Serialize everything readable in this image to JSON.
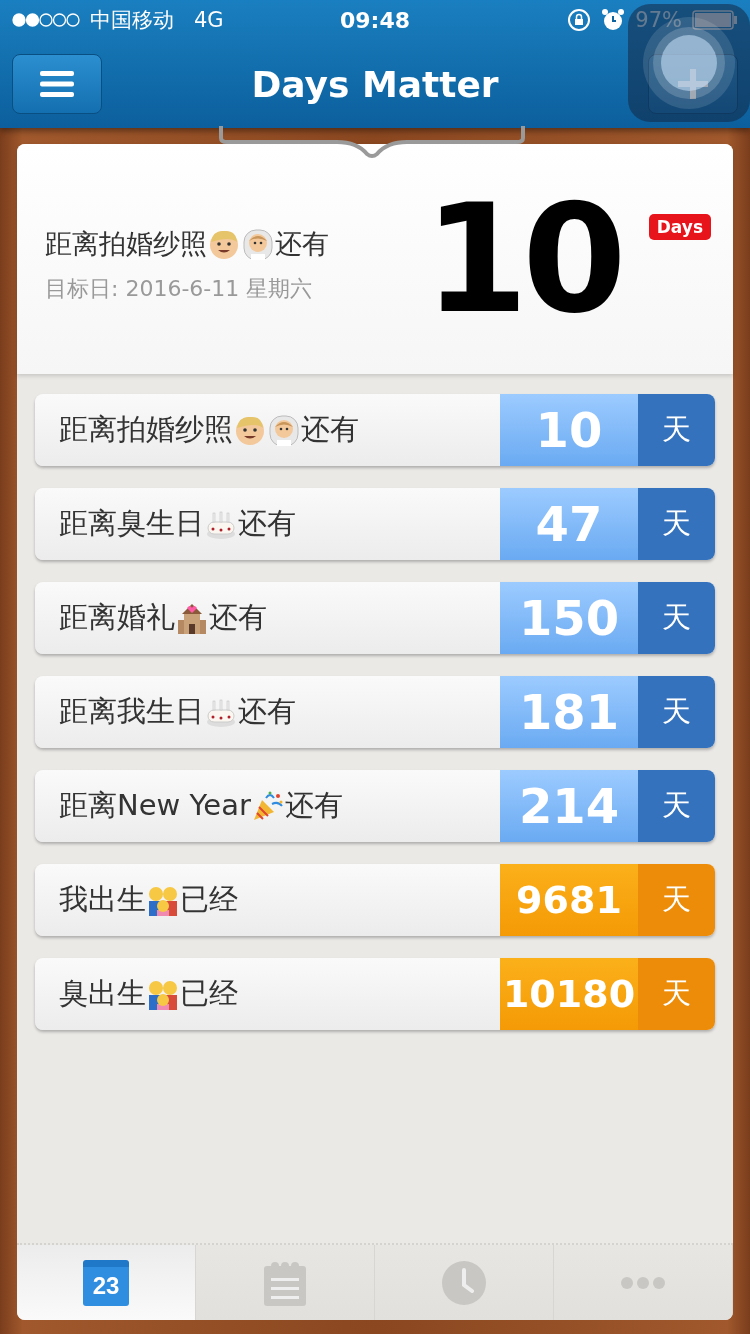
{
  "status_bar": {
    "carrier": "中国移动",
    "network": "4G",
    "time": "09:48",
    "battery": "97%"
  },
  "nav": {
    "title": "Days Matter"
  },
  "featured": {
    "label": [
      {
        "kind": "text",
        "text": "距离拍婚纱照"
      },
      {
        "kind": "man"
      },
      {
        "kind": "bride"
      },
      {
        "kind": "text",
        "text": "还有"
      }
    ],
    "target_date": "目标日: 2016-6-11 星期六",
    "count": "10",
    "unit_badge": "Days"
  },
  "events": [
    {
      "kind": "countdown",
      "label": [
        {
          "kind": "text",
          "text": "距离拍婚纱照"
        },
        {
          "kind": "man"
        },
        {
          "kind": "bride"
        },
        {
          "kind": "text",
          "text": "还有"
        }
      ],
      "count": "10",
      "unit": "天"
    },
    {
      "kind": "countdown",
      "label": [
        {
          "kind": "text",
          "text": "距离臭生日"
        },
        {
          "kind": "cake"
        },
        {
          "kind": "text",
          "text": "还有"
        }
      ],
      "count": "47",
      "unit": "天"
    },
    {
      "kind": "countdown",
      "label": [
        {
          "kind": "text",
          "text": "距离婚礼"
        },
        {
          "kind": "church"
        },
        {
          "kind": "text",
          "text": "还有"
        }
      ],
      "count": "150",
      "unit": "天"
    },
    {
      "kind": "countdown",
      "label": [
        {
          "kind": "text",
          "text": "距离我生日"
        },
        {
          "kind": "cake"
        },
        {
          "kind": "text",
          "text": "还有"
        }
      ],
      "count": "181",
      "unit": "天"
    },
    {
      "kind": "countdown",
      "label": [
        {
          "kind": "text",
          "text": "距离New Year"
        },
        {
          "kind": "party"
        },
        {
          "kind": "text",
          "text": "还有"
        }
      ],
      "count": "214",
      "unit": "天"
    },
    {
      "kind": "elapsed",
      "label": [
        {
          "kind": "text",
          "text": "我出生"
        },
        {
          "kind": "family"
        },
        {
          "kind": "text",
          "text": "已经"
        }
      ],
      "count": "9681",
      "unit": "天"
    },
    {
      "kind": "elapsed",
      "label": [
        {
          "kind": "text",
          "text": "臭出生"
        },
        {
          "kind": "family"
        },
        {
          "kind": "text",
          "text": "已经"
        }
      ],
      "count": "10180",
      "unit": "天"
    }
  ],
  "tabs": [
    {
      "kind": "calendar",
      "day": "23",
      "selected": true
    },
    {
      "kind": "notes",
      "selected": false
    },
    {
      "kind": "clock",
      "selected": false
    },
    {
      "kind": "more",
      "selected": false
    }
  ]
}
